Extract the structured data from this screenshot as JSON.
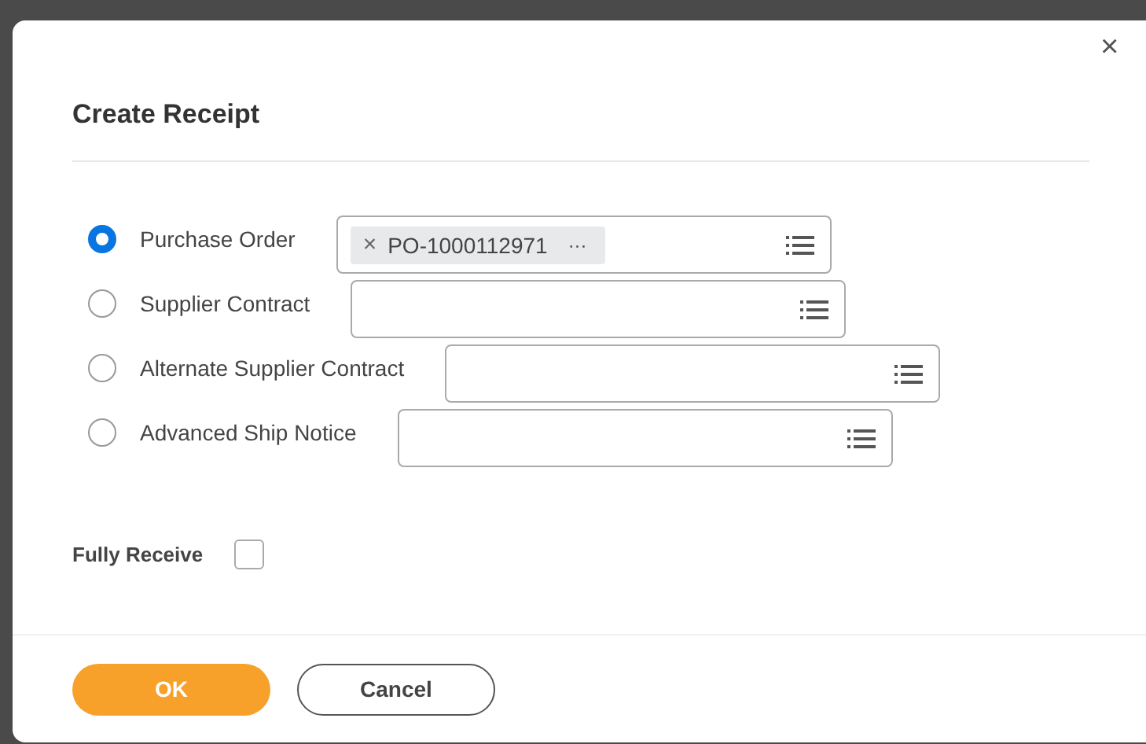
{
  "dialog": {
    "title": "Create Receipt",
    "close": "×"
  },
  "options": [
    {
      "label": "Purchase Order",
      "selected": true,
      "tokens": [
        {
          "remove": "×",
          "value": "PO-1000112971",
          "more": "···"
        }
      ]
    },
    {
      "label": "Supplier Contract",
      "selected": false
    },
    {
      "label": "Alternate Supplier Contract",
      "selected": false
    },
    {
      "label": "Advanced Ship Notice",
      "selected": false
    }
  ],
  "fully_receive": {
    "label": "Fully Receive",
    "checked": false
  },
  "buttons": [
    {
      "label": "OK",
      "kind": "primary"
    },
    {
      "label": "Cancel",
      "kind": "secondary"
    }
  ]
}
